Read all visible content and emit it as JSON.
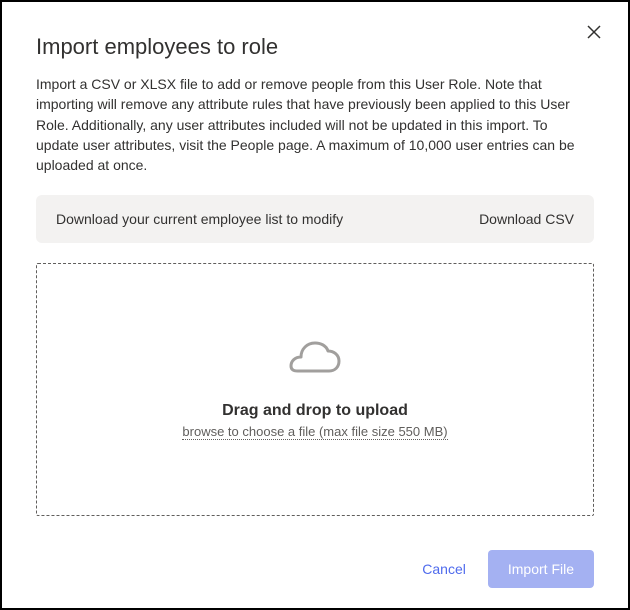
{
  "dialog": {
    "title": "Import employees to role",
    "description": "Import a CSV or XLSX file to add or remove people from this User Role. Note that importing will remove any attribute rules that have previously been applied to this User Role. Additionally, any user attributes included will not be updated in this import. To update user attributes, visit the People page. A maximum of 10,000 user entries can be uploaded at once."
  },
  "download_bar": {
    "text": "Download your current employee list to modify",
    "link_label": "Download CSV"
  },
  "dropzone": {
    "title": "Drag and drop to upload",
    "browse_text": "browse to choose a file (max file size 550 MB)"
  },
  "footer": {
    "cancel_label": "Cancel",
    "import_label": "Import File"
  }
}
